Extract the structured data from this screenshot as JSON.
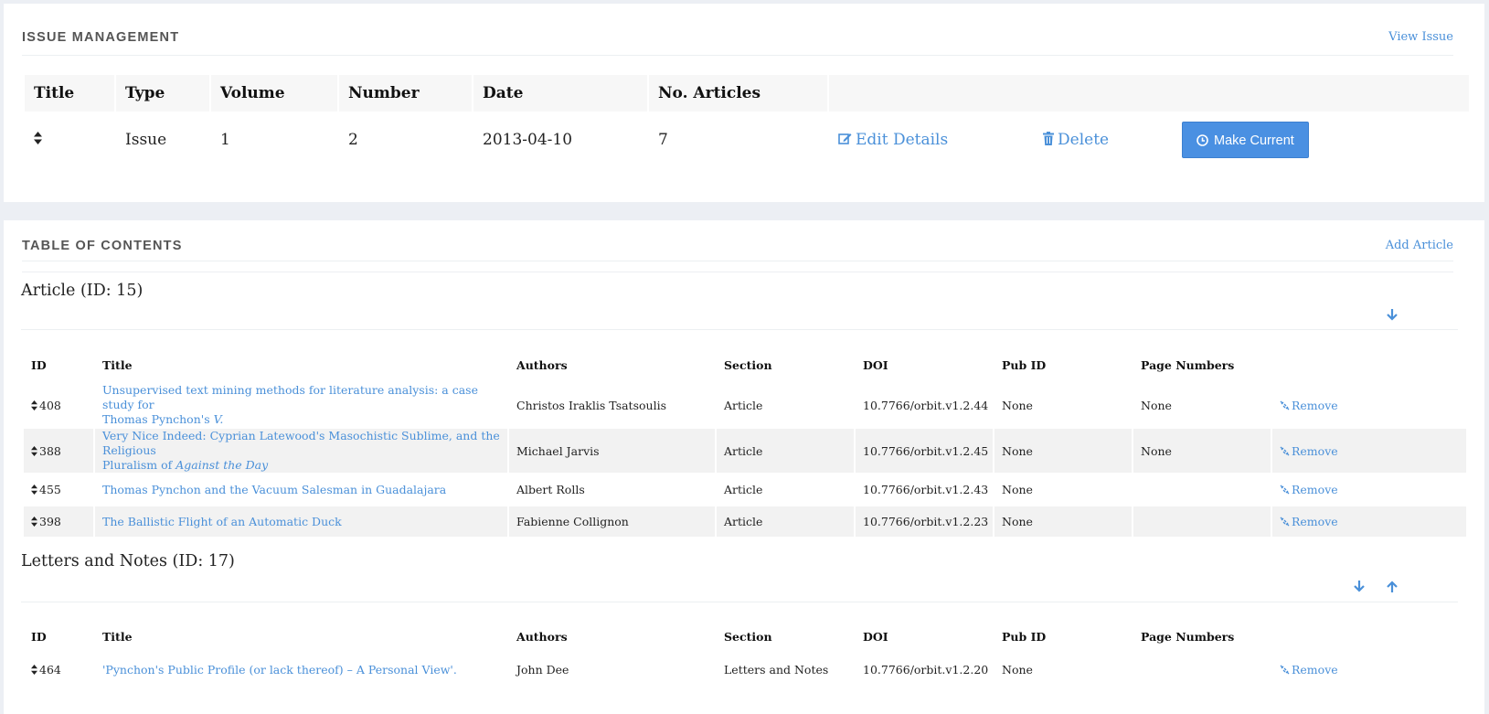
{
  "issue_panel": {
    "title": "ISSUE MANAGEMENT",
    "view_link": "View Issue",
    "columns": [
      "Title",
      "Type",
      "Volume",
      "Number",
      "Date",
      "No. Articles"
    ],
    "row": {
      "type": "Issue",
      "volume": "1",
      "number": "2",
      "date": "2013-04-10",
      "articles": "7",
      "edit_label": "Edit Details",
      "delete_label": "Delete",
      "make_current_label": "Make Current"
    }
  },
  "toc_panel": {
    "title": "TABLE OF CONTENTS",
    "add_link": "Add Article",
    "columns": [
      "ID",
      "Title",
      "Authors",
      "Section",
      "DOI",
      "Pub ID",
      "Page Numbers"
    ],
    "remove_label": "Remove",
    "sections": [
      {
        "heading": "Article (ID: 15)",
        "rows": [
          {
            "id": "408",
            "title_line1": "Unsupervised text mining methods for literature analysis: a case study for",
            "title_line2": "Thomas Pynchon's ",
            "title_italic": "V.",
            "authors": "Christos Iraklis Tsatsoulis",
            "section": "Article",
            "doi": "10.7766/orbit.v1.2.44",
            "pub_id": "None",
            "pages": "None"
          },
          {
            "id": "388",
            "title_line1": "Very Nice Indeed: Cyprian Latewood's Masochistic Sublime, and the Religious",
            "title_line2": "Pluralism of ",
            "title_italic": "Against the Day",
            "authors": "Michael Jarvis",
            "section": "Article",
            "doi": "10.7766/orbit.v1.2.45",
            "pub_id": "None",
            "pages": "None"
          },
          {
            "id": "455",
            "title_line1": "Thomas Pynchon and the Vacuum Salesman in Guadalajara",
            "title_line2": "",
            "title_italic": "",
            "authors": "Albert Rolls",
            "section": "Article",
            "doi": "10.7766/orbit.v1.2.43",
            "pub_id": "None",
            "pages": ""
          },
          {
            "id": "398",
            "title_line1": "The Ballistic Flight of an Automatic Duck",
            "title_line2": "",
            "title_italic": "",
            "authors": "Fabienne Collignon",
            "section": "Article",
            "doi": "10.7766/orbit.v1.2.23",
            "pub_id": "None",
            "pages": ""
          }
        ]
      },
      {
        "heading": "Letters and Notes (ID: 17)",
        "rows": [
          {
            "id": "464",
            "title_line1": "'Pynchon's Public Profile (or lack thereof) – A Personal View'.",
            "title_line2": "",
            "title_italic": "",
            "authors": "John Dee",
            "section": "Letters and Notes",
            "doi": "10.7766/orbit.v1.2.20",
            "pub_id": "None",
            "pages": ""
          }
        ]
      }
    ]
  },
  "colors": {
    "link": "#4a90d9",
    "primary_button": "#4a90e2",
    "panel_bg": "#ffffff",
    "page_bg": "#eceff4"
  },
  "icons": [
    "sort-icon",
    "edit-icon",
    "trash-icon",
    "clock-icon",
    "arrow-down-icon",
    "arrow-up-icon",
    "unlink-icon"
  ]
}
